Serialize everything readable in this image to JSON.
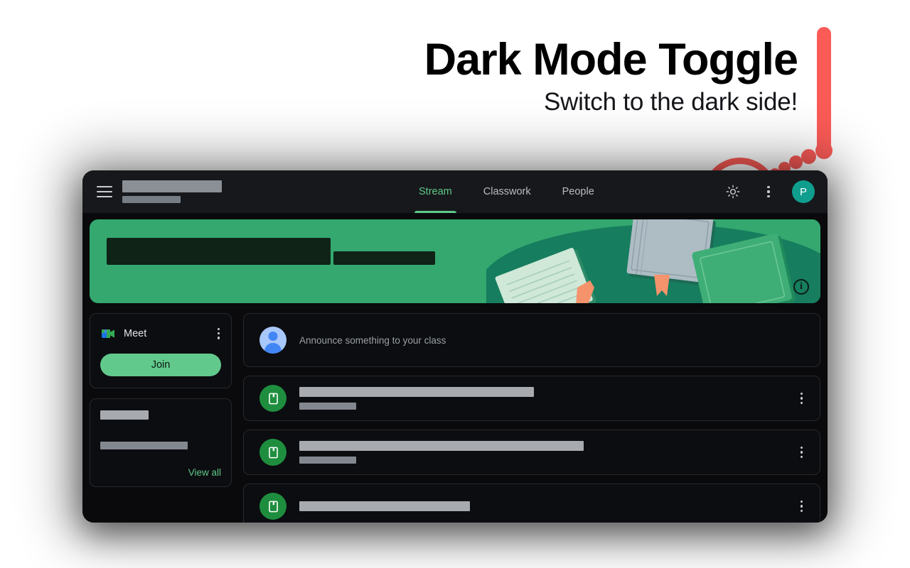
{
  "annotation": {
    "headline": "Dark Mode Toggle",
    "subhead": "Switch to the dark side!",
    "accent_color": "#fb5b57",
    "pointer_target": "theme-toggle-button",
    "bar_icon": "vertical-pointer-bar",
    "ring_icon": "highlight-ring"
  },
  "app": {
    "topbar": {
      "menu_icon": "hamburger-menu-icon",
      "class_title_redacted": true,
      "class_section_redacted": true,
      "tabs": [
        {
          "label": "Stream",
          "active": true
        },
        {
          "label": "Classwork",
          "active": false
        },
        {
          "label": "People",
          "active": false
        }
      ],
      "theme_toggle_icon": "sun-brightness-icon",
      "overflow_icon": "kebab-menu-icon",
      "avatar_initial": "P",
      "avatar_color": "#0f9e8d",
      "active_tab_color": "#5ec98a",
      "bar_color": "#17181b"
    },
    "hero": {
      "background_color": "#34a86f",
      "title_redacted": true,
      "subtitle_redacted": true,
      "info_icon": "info-circle-icon",
      "illustration": "books-and-notebooks-illustration"
    },
    "sidebar": {
      "meet_card": {
        "icon": "google-meet-icon",
        "label": "Meet",
        "overflow_icon": "kebab-menu-icon",
        "join_label": "Join",
        "join_color": "#62c98c"
      },
      "upcoming_card": {
        "heading_redacted": true,
        "body_redacted": true,
        "view_all_label": "View all",
        "link_color": "#5ec98a"
      }
    },
    "stream": {
      "composer": {
        "avatar_icon": "user-avatar-icon",
        "placeholder": "Announce something to your class"
      },
      "posts": [
        {
          "icon": "material-book-icon",
          "icon_color": "#1e8e3e",
          "title_redacted": true,
          "date_redacted": true,
          "overflow_icon": "kebab-menu-icon",
          "title_width": 330,
          "date_width": 80
        },
        {
          "icon": "material-book-icon",
          "icon_color": "#1e8e3e",
          "title_redacted": true,
          "date_redacted": true,
          "overflow_icon": "kebab-menu-icon",
          "title_width": 400,
          "date_width": 80
        },
        {
          "icon": "material-book-icon",
          "icon_color": "#1e8e3e",
          "title_redacted": true,
          "date_redacted": false,
          "overflow_icon": "kebab-menu-icon",
          "title_width": 240,
          "date_width": 0
        }
      ]
    },
    "window": {
      "background_color": "#0a0a0c",
      "card_color": "#0c0d10",
      "border_color": "#27282c"
    }
  }
}
